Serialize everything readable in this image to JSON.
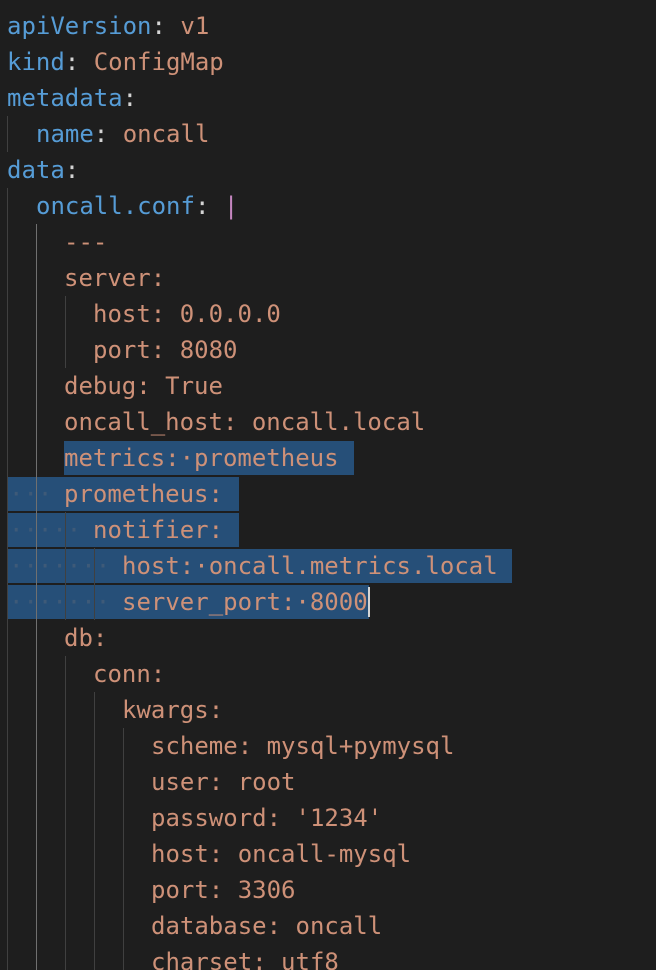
{
  "editor": {
    "language": "yaml",
    "colors": {
      "background": "#1e1e1e",
      "key": "#569cd6",
      "string_value": "#ce9178",
      "punctuation": "#d4d4d4",
      "block_indicator": "#c586c0",
      "selection": "#264f78",
      "indent_guide": "#404040"
    },
    "lines": [
      {
        "key": "apiVersion",
        "sep": ":",
        "value": "v1"
      },
      {
        "key": "kind",
        "sep": ":",
        "value": "ConfigMap"
      },
      {
        "key": "metadata",
        "sep": ":",
        "value": ""
      },
      {
        "key": "name",
        "sep": ":",
        "value": "oncall"
      },
      {
        "key": "data",
        "sep": ":",
        "value": ""
      },
      {
        "key": "oncall.conf",
        "sep": ":",
        "value": "|"
      },
      {
        "key": "",
        "sep": "",
        "value": "---"
      },
      {
        "key": "",
        "sep": "",
        "value": "server:"
      },
      {
        "key": "",
        "sep": "",
        "value": "host: 0.0.0.0"
      },
      {
        "key": "",
        "sep": "",
        "value": "port: 8080"
      },
      {
        "key": "",
        "sep": "",
        "value": "debug: True"
      },
      {
        "key": "",
        "sep": "",
        "value": "oncall_host: oncall.local"
      },
      {
        "key": "",
        "sep": "",
        "value": "metrics:·prometheus"
      },
      {
        "key": "",
        "sep": "",
        "value": "prometheus:"
      },
      {
        "key": "",
        "sep": "",
        "value": "notifier:"
      },
      {
        "key": "",
        "sep": "",
        "value": "host:·oncall.metrics.local"
      },
      {
        "key": "",
        "sep": "",
        "value": "server_port:·8000"
      },
      {
        "key": "",
        "sep": "",
        "value": "db:"
      },
      {
        "key": "",
        "sep": "",
        "value": "conn:"
      },
      {
        "key": "",
        "sep": "",
        "value": "kwargs:"
      },
      {
        "key": "",
        "sep": "",
        "value": "scheme: mysql+pymysql"
      },
      {
        "key": "",
        "sep": "",
        "value": "user: root"
      },
      {
        "key": "",
        "sep": "",
        "value": "password: '1234'"
      },
      {
        "key": "",
        "sep": "",
        "value": "host: oncall-mysql"
      },
      {
        "key": "",
        "sep": "",
        "value": "port: 3306"
      },
      {
        "key": "",
        "sep": "",
        "value": "database: oncall"
      },
      {
        "key": "",
        "sep": "",
        "value": "charset: utf8"
      }
    ]
  }
}
